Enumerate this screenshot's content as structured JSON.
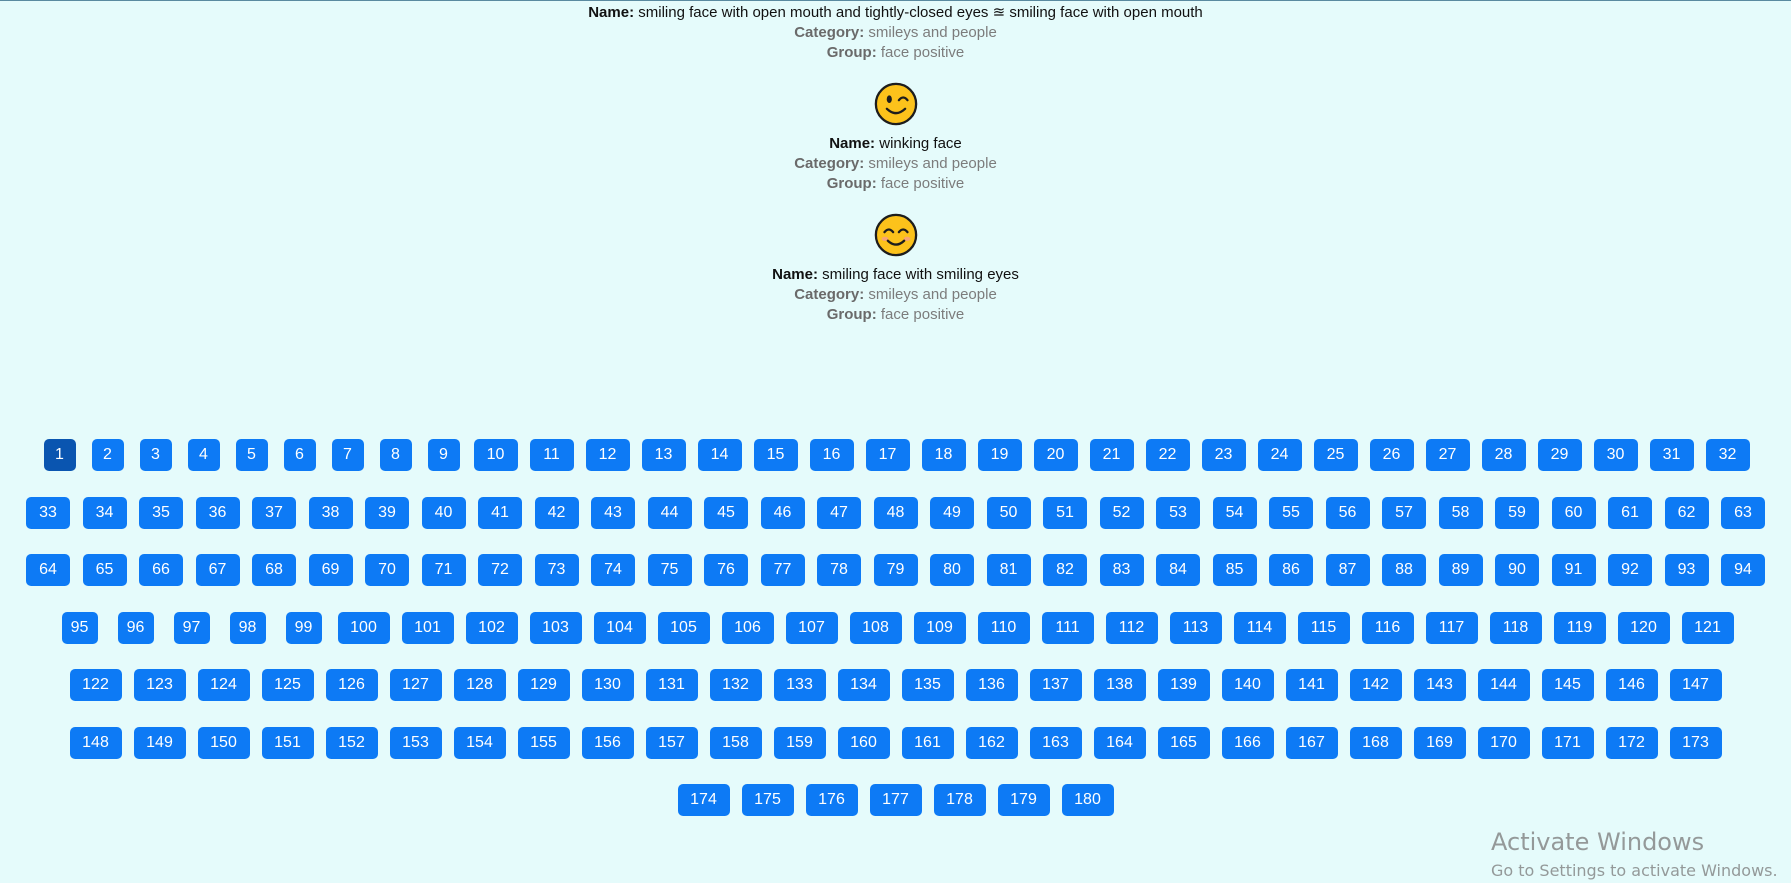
{
  "emojis": [
    {
      "name_label": "Name:",
      "name": "smiling face with open mouth and tightly-closed eyes ≊ smiling face with open mouth",
      "category_label": "Category:",
      "category": "smileys and people",
      "group_label": "Group:",
      "group": "face positive"
    },
    {
      "glyph": "winking-face-icon",
      "name_label": "Name:",
      "name": "winking face",
      "category_label": "Category:",
      "category": "smileys and people",
      "group_label": "Group:",
      "group": "face positive"
    },
    {
      "glyph": "smiling-face-with-smiling-eyes-icon",
      "name_label": "Name:",
      "name": "smiling face with smiling eyes",
      "category_label": "Category:",
      "category": "smileys and people",
      "group_label": "Group:",
      "group": "face positive"
    }
  ],
  "pagination": {
    "active_page": 1,
    "rows": [
      [
        "1",
        "2",
        "3",
        "4",
        "5",
        "6",
        "7",
        "8",
        "9",
        "10",
        "11",
        "12",
        "13",
        "14",
        "15",
        "16",
        "17",
        "18",
        "19",
        "20",
        "21",
        "22",
        "23",
        "24",
        "25",
        "26",
        "27",
        "28",
        "29",
        "30",
        "31",
        "32"
      ],
      [
        "33",
        "34",
        "35",
        "36",
        "37",
        "38",
        "39",
        "40",
        "41",
        "42",
        "43",
        "44",
        "45",
        "46",
        "47",
        "48",
        "49",
        "50",
        "51",
        "52",
        "53",
        "54",
        "55",
        "56",
        "57",
        "58",
        "59",
        "60",
        "61",
        "62",
        "63"
      ],
      [
        "64",
        "65",
        "66",
        "67",
        "68",
        "69",
        "70",
        "71",
        "72",
        "73",
        "74",
        "75",
        "76",
        "77",
        "78",
        "79",
        "80",
        "81",
        "82",
        "83",
        "84",
        "85",
        "86",
        "87",
        "88",
        "89",
        "90",
        "91",
        "92",
        "93",
        "94"
      ],
      [
        "95",
        "96",
        "97",
        "98",
        "99",
        "100",
        "101",
        "102",
        "103",
        "104",
        "105",
        "106",
        "107",
        "108",
        "109",
        "110",
        "111",
        "112",
        "113",
        "114",
        "115",
        "116",
        "117",
        "118",
        "119",
        "120",
        "121"
      ],
      [
        "122",
        "123",
        "124",
        "125",
        "126",
        "127",
        "128",
        "129",
        "130",
        "131",
        "132",
        "133",
        "134",
        "135",
        "136",
        "137",
        "138",
        "139",
        "140",
        "141",
        "142",
        "143",
        "144",
        "145",
        "146",
        "147"
      ],
      [
        "148",
        "149",
        "150",
        "151",
        "152",
        "153",
        "154",
        "155",
        "156",
        "157",
        "158",
        "159",
        "160",
        "161",
        "162",
        "163",
        "164",
        "165",
        "166",
        "167",
        "168",
        "169",
        "170",
        "171",
        "172",
        "173"
      ],
      [
        "174",
        "175",
        "176",
        "177",
        "178",
        "179",
        "180"
      ]
    ]
  },
  "colors": {
    "background": "#e5fbfb",
    "button": "#0d7af5",
    "button_active": "#0a55b0",
    "emoji_fill": "#fcc21b"
  },
  "watermark": {
    "title": "Activate Windows",
    "subtitle": "Go to Settings to activate Windows."
  }
}
